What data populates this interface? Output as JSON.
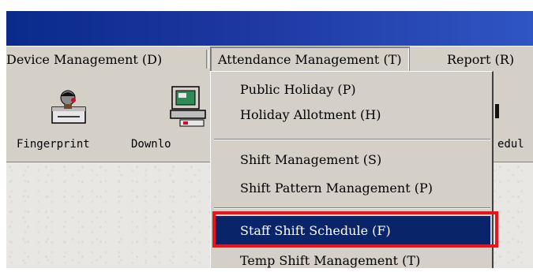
{
  "menubar": {
    "items": [
      {
        "label": "Device Management (D)"
      },
      {
        "label": "Attendance Management (T)"
      },
      {
        "label": "Report (R)"
      }
    ]
  },
  "toolbar": {
    "buttons": [
      {
        "label": "Fingerprint",
        "icon": "fingerprint-scanner-icon"
      },
      {
        "label": "Downlo",
        "icon": "download-computer-icon"
      },
      {
        "label": "edul",
        "icon": "schedule-icon"
      }
    ]
  },
  "dropdown": {
    "items": [
      {
        "label": "Public Holiday (P)"
      },
      {
        "label": "Holiday Allotment (H)"
      },
      {
        "label": "Shift Management (S)"
      },
      {
        "label": "Shift Pattern Management (P)"
      },
      {
        "label": "Staff Shift Schedule (F)",
        "selected": true
      },
      {
        "label": "Temp Shift Management (T)"
      }
    ]
  },
  "colors": {
    "title_bar": "#0a2a8c",
    "selection": "#0a246a",
    "highlight_frame": "#e8151c",
    "face": "#d4d0c8"
  }
}
